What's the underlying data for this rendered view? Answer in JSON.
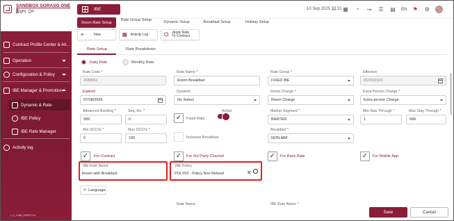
{
  "sidebar": {
    "hotel_name": "SANDBOX SORASO ONE 2",
    "right": "Right: QA",
    "items": [
      {
        "label": "Contract Profile Center & All..."
      },
      {
        "label": "Operation"
      },
      {
        "label": "Configuration & Policy"
      },
      {
        "label": "IBE Manager & Promotion"
      },
      {
        "label": "Dynamic & Rate"
      },
      {
        "label": "IBE Policy"
      },
      {
        "label": "IBE Rate Manager"
      },
      {
        "label": "Activity log"
      }
    ],
    "version": "1_1_1JAN_20250717A"
  },
  "topbar": {
    "module_tab": "IBE",
    "datetime": "10 Sep 2025  12:31",
    "language": "EN"
  },
  "tabs": [
    {
      "label": "Room Rate Setup"
    },
    {
      "label": "Rate Group Setup"
    },
    {
      "label": "Dynamic Setup"
    },
    {
      "label": "Breakfast Setup"
    },
    {
      "label": "Holiday Setup"
    }
  ],
  "toolbar": {
    "new_label": "New",
    "activity_log_label": "Activity Log",
    "apply_rate_label_1": "Apply Rate",
    "apply_rate_label_2": "To Contract"
  },
  "subtabs": {
    "rate_setup": "Rate Setup",
    "rate_breakdown": "Rate Breakdown"
  },
  "radios": {
    "daily_rate": "Daily Rate",
    "monthly_rate": "Monthly Rate"
  },
  "form": {
    "rate_code": {
      "label": "Rate Code",
      "value": "2RBB51"
    },
    "rate_name": {
      "label": "Rate Name",
      "value": "Room Breakfast"
    },
    "rate_group": {
      "label": "Rate Group",
      "value": "FIXED IBE"
    },
    "effective": {
      "label": "Effective",
      "value": "05/09/2024"
    },
    "expired": {
      "label": "Expired",
      "value": "07/08/2026"
    },
    "dynamic": {
      "label": "Dynamic",
      "value": "No Select"
    },
    "room_charge": {
      "label": "Room Charge",
      "value": "Room Charge"
    },
    "extra_person_charge": {
      "label": "Extra Person Charge",
      "value": "Extra person Charge"
    },
    "advanced_booking": {
      "label": "Advanced Booking",
      "value": "999"
    },
    "seq_no": {
      "label": "Seq. No.",
      "value": "0"
    },
    "fixed_rate": {
      "label": "Fixed Rate"
    },
    "active": {
      "label": "Active"
    },
    "market_segment": {
      "label": "Market Segment",
      "value": "BARTER"
    },
    "min_stay": {
      "label": "Min Stay Through",
      "value": "1"
    },
    "max_stay": {
      "label": "Max Stay Through",
      "value": "999"
    },
    "min_occ": {
      "label": "Min OCC%",
      "value": "0"
    },
    "max_occ": {
      "label": "Max OCC%",
      "value": "100"
    },
    "inclusive_breakfast": {
      "label": "Inclusive Breakfast"
    },
    "breakfast": {
      "label": "Breakfast",
      "value": "NON ABF"
    }
  },
  "channels": {
    "for_contract": "For Contract",
    "for_3rd_party": "For 3rd Party Channel",
    "for_rack_rate": "For Rack Rate",
    "for_mobile_app": "For Mobile App"
  },
  "ibe": {
    "rate_name_label": "IBE Rate Name",
    "rate_name_value": "Room with Breakfast",
    "policy_label": "IBE Policy",
    "policy_value": "POLY02 - Policy Non Refund"
  },
  "language_button": "Language",
  "language_table": {
    "col_rate_name": "Rate Name",
    "col_ibe_rate_name": "IBE Rate Name"
  },
  "actions": {
    "save": "Save",
    "cancel": "Cancel"
  },
  "colors": {
    "brand": "#8a1d38",
    "highlight": "#e02020"
  }
}
